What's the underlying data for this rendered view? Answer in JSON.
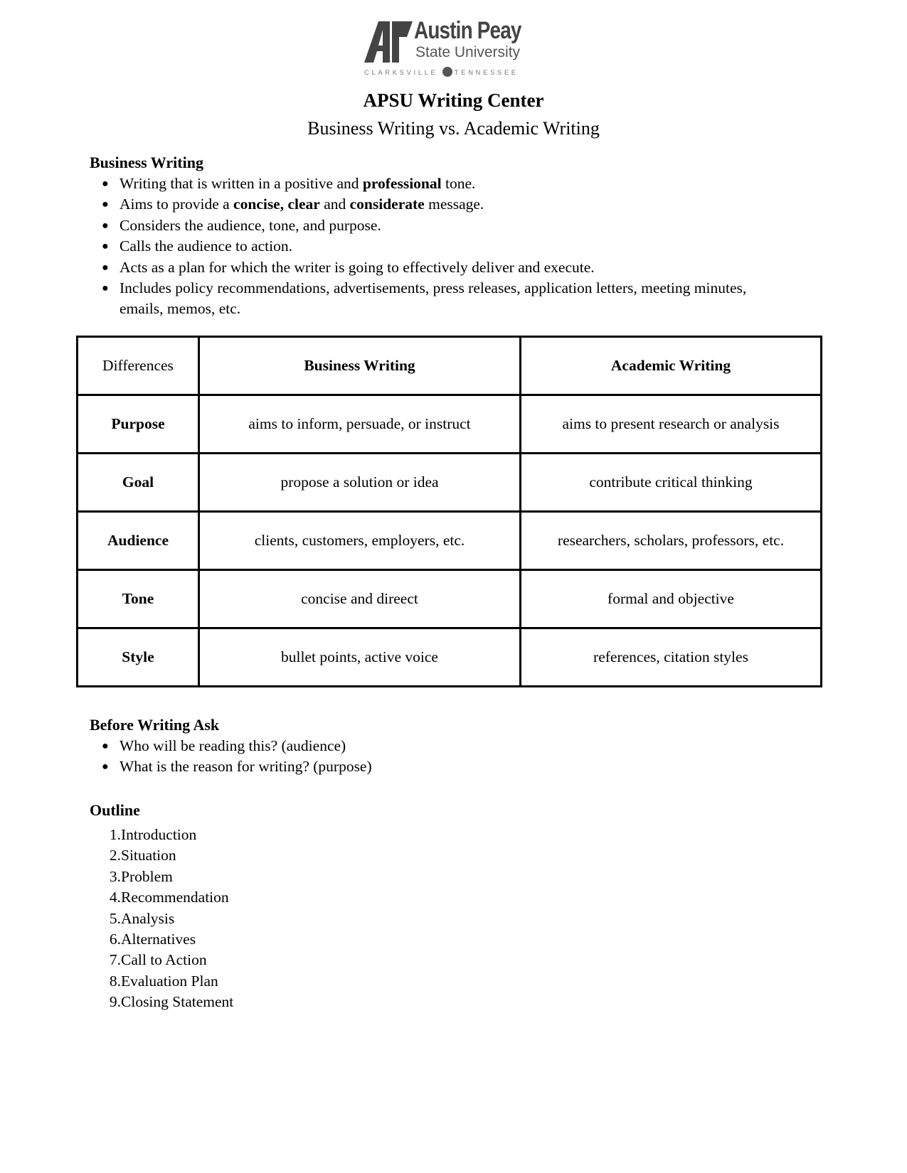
{
  "logo": {
    "line1": "Austin Peay",
    "line2": "State University",
    "city": "CLARKSVILLE",
    "state": "TENNESSEE",
    "icon": "ap-monogram-icon"
  },
  "header": {
    "title": "APSU Writing Center",
    "subtitle": "Business Writing vs. Academic Writing"
  },
  "business_writing": {
    "heading": "Business Writing",
    "items": [
      [
        {
          "t": "Writing that is written in a positive and ",
          "b": false
        },
        {
          "t": "professional",
          "b": true
        },
        {
          "t": " tone.",
          "b": false
        }
      ],
      [
        {
          "t": "Aims to provide a ",
          "b": false
        },
        {
          "t": "concise, clear",
          "b": true
        },
        {
          "t": " and ",
          "b": false
        },
        {
          "t": "considerate",
          "b": true
        },
        {
          "t": " message.",
          "b": false
        }
      ],
      [
        {
          "t": "Considers the audience, tone, and purpose.",
          "b": false
        }
      ],
      [
        {
          "t": "Calls the audience to action.",
          "b": false
        }
      ],
      [
        {
          "t": "Acts as a plan for which the writer is going to effectively deliver and execute.",
          "b": false
        }
      ],
      [
        {
          "t": "Includes policy recommendations, advertisements, press releases, application letters, meeting minutes, emails, memos, etc.",
          "b": false
        }
      ]
    ]
  },
  "comparison_table": {
    "headers": [
      "Differences",
      "Business Writing",
      "Academic Writing"
    ],
    "rows": [
      {
        "label": "Purpose",
        "business": "aims to inform, persuade, or instruct",
        "academic": "aims to present research or analysis"
      },
      {
        "label": "Goal",
        "business": "propose a solution or idea",
        "academic": "contribute critical thinking"
      },
      {
        "label": "Audience",
        "business": "clients, customers, employers, etc.",
        "academic": "researchers, scholars, professors, etc."
      },
      {
        "label": "Tone",
        "business": "concise and direect",
        "academic": "formal and objective"
      },
      {
        "label": "Style",
        "business": "bullet points, active voice",
        "academic": "references, citation styles"
      }
    ]
  },
  "before_writing": {
    "heading": "Before Writing Ask",
    "items": [
      "Who will be reading this? (audience)",
      "What is the reason for writing? (purpose)"
    ]
  },
  "outline": {
    "heading": "Outline",
    "items": [
      "Introduction",
      "Situation",
      "Problem",
      "Recommendation",
      "Analysis",
      "Alternatives",
      "Call to Action",
      "Evaluation Plan",
      "Closing Statement"
    ]
  }
}
